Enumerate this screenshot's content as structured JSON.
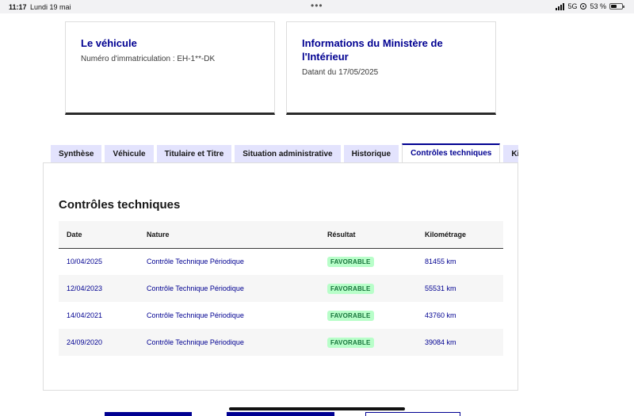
{
  "status_bar": {
    "time": "11:17",
    "date": "Lundi 19 mai",
    "network": "5G",
    "battery": "53 %",
    "battery_level": 0.53
  },
  "cards": [
    {
      "title": "Le véhicule",
      "description": "Numéro d'immatriculation : EH-1**-DK"
    },
    {
      "title": "Informations du Ministère de l'Intérieur",
      "description": "Datant du 17/05/2025"
    }
  ],
  "tabs": [
    {
      "label": "Synthèse",
      "active": false
    },
    {
      "label": "Véhicule",
      "active": false
    },
    {
      "label": "Titulaire et Titre",
      "active": false
    },
    {
      "label": "Situation administrative",
      "active": false
    },
    {
      "label": "Historique",
      "active": false
    },
    {
      "label": "Contrôles techniques",
      "active": true
    },
    {
      "label": "Kilométrage",
      "active": false
    }
  ],
  "panel": {
    "title": "Contrôles techniques",
    "columns": [
      "Date",
      "Nature",
      "Résultat",
      "Kilométrage"
    ],
    "rows": [
      {
        "date": "10/04/2025",
        "nature": "Contrôle Technique Périodique",
        "result": "FAVORABLE",
        "km": "81455 km"
      },
      {
        "date": "12/04/2023",
        "nature": "Contrôle Technique Périodique",
        "result": "FAVORABLE",
        "km": "55531 km"
      },
      {
        "date": "14/04/2021",
        "nature": "Contrôle Technique Périodique",
        "result": "FAVORABLE",
        "km": "43760 km"
      },
      {
        "date": "24/09/2020",
        "nature": "Contrôle Technique Périodique",
        "result": "FAVORABLE",
        "km": "39084 km"
      }
    ]
  },
  "colors": {
    "brand_blue": "#000091",
    "tab_bg": "#e3e3fd",
    "success_bg": "#b8fec9",
    "success_text": "#18753c"
  }
}
